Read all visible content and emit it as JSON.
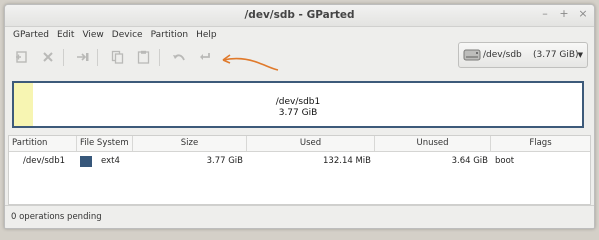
{
  "window": {
    "title": "/dev/sdb - GParted",
    "controls": [
      "–",
      "+",
      "×"
    ]
  },
  "menu": [
    "GParted",
    "Edit",
    "View",
    "Device",
    "Partition",
    "Help"
  ],
  "toolbar": {
    "icons": [
      "new-partition-icon",
      "delete-icon",
      "resize-move-icon",
      "copy-icon",
      "paste-icon",
      "undo-icon",
      "apply-icon"
    ]
  },
  "device_selector": {
    "device": "/dev/sdb",
    "size": "(3.77 GiB)",
    "arrow": "▼"
  },
  "partition_map": {
    "name": "/dev/sdb1",
    "size": "3.77 GiB",
    "used_fraction": 0.034
  },
  "table": {
    "headers": [
      "Partition",
      "File System",
      "Size",
      "Used",
      "Unused",
      "Flags"
    ],
    "rows": [
      {
        "partition": "/dev/sdb1",
        "filesystem": "ext4",
        "fs_color": "#37577a",
        "size": "3.77 GiB",
        "used": "132.14 MiB",
        "unused": "3.64 GiB",
        "flags": "boot"
      }
    ]
  },
  "status": "0 operations pending",
  "colors": {
    "annotation_arrow": "#e07a2c",
    "partition_border": "#3d5a7a",
    "used_fill": "#f7f5b2"
  }
}
